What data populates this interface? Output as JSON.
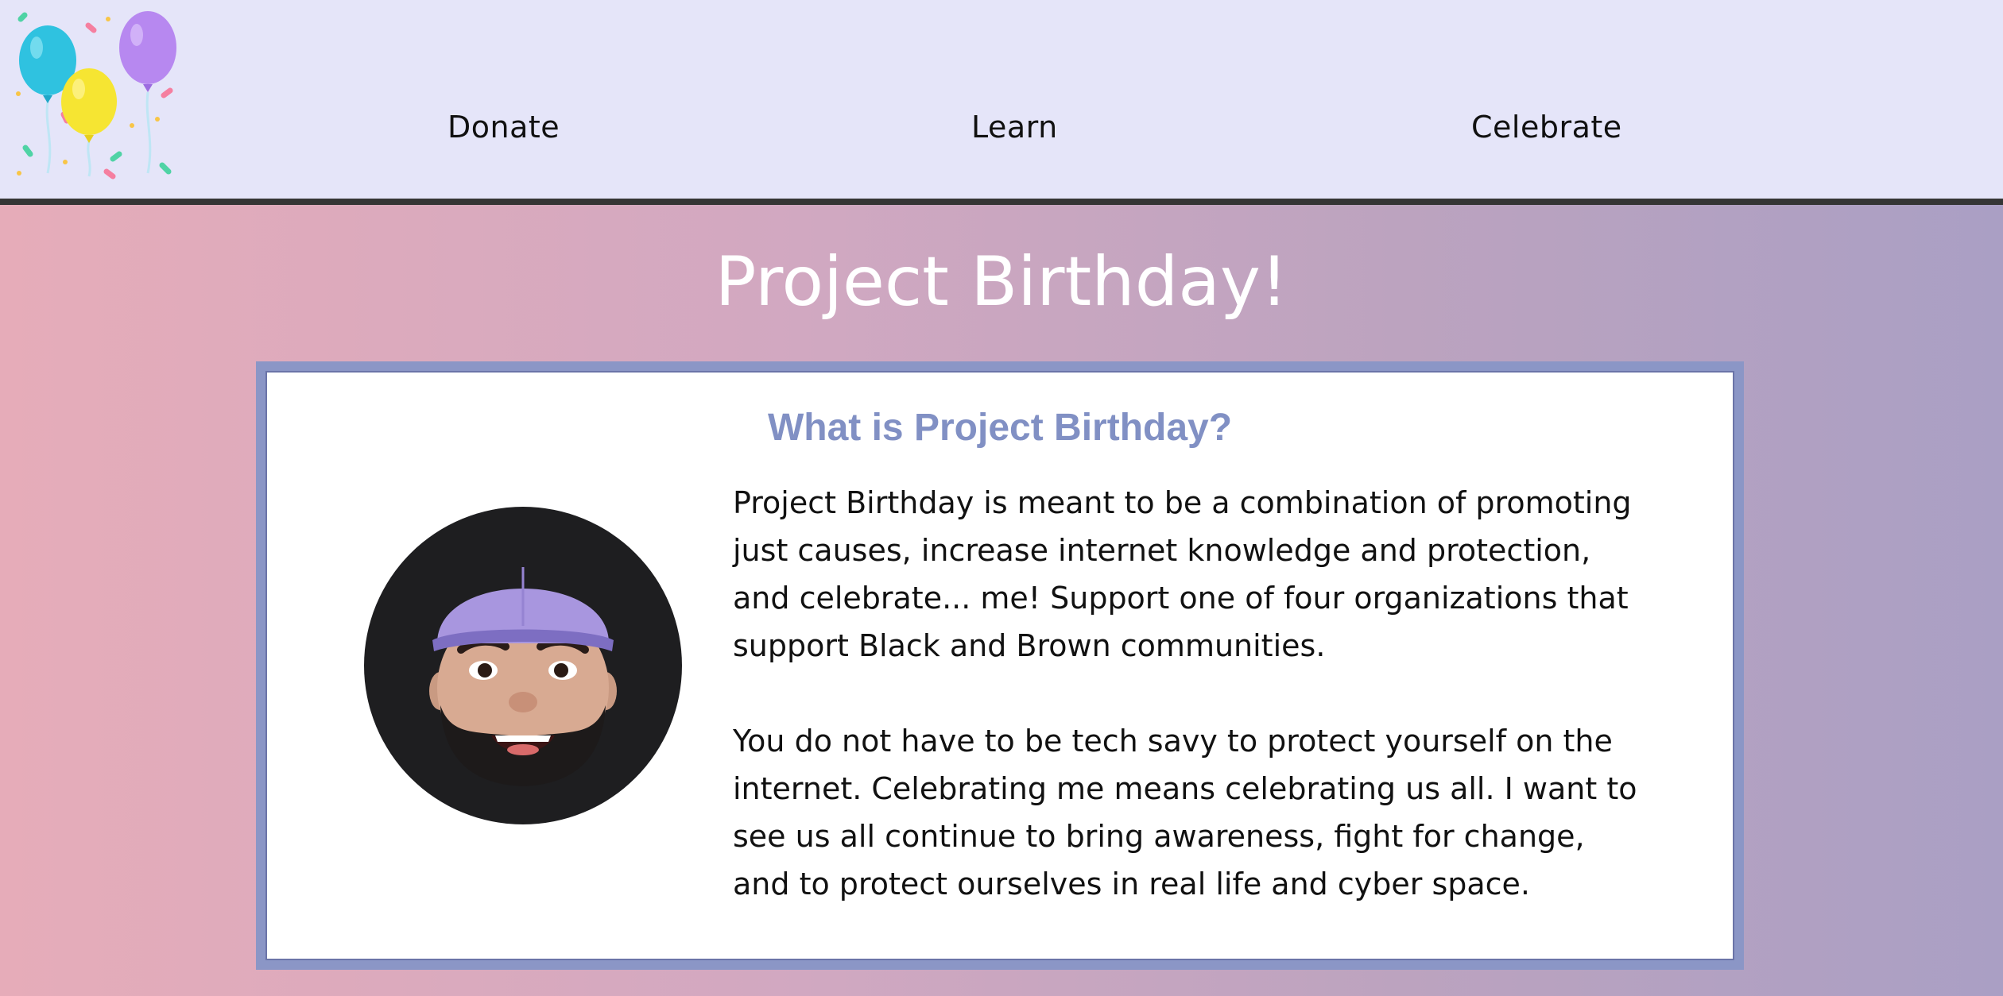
{
  "nav": {
    "logo_icon": "balloons-confetti-icon",
    "items": [
      {
        "label": "Donate"
      },
      {
        "label": "Learn"
      },
      {
        "label": "Celebrate"
      }
    ]
  },
  "page": {
    "title": "Project Birthday!"
  },
  "card": {
    "heading": "What is Project Birthday?",
    "avatar_icon": "memoji-avatar-icon",
    "paragraphs": [
      "Project Birthday is meant to be a combination of promoting just causes, increase internet knowledge and protection, and celebrate... me! Support one of four organizations that support Black and Brown communities.",
      "You do not have to be tech savy to protect yourself on the internet. Celebrating me means celebrating us all. I want to see us all continue to bring awareness, fight for change, and to protect ourselves in real life and cyber space."
    ]
  },
  "colors": {
    "nav_bg": "#e5e5f9",
    "heading": "#8190c4",
    "card_border": "#8b96c6"
  }
}
